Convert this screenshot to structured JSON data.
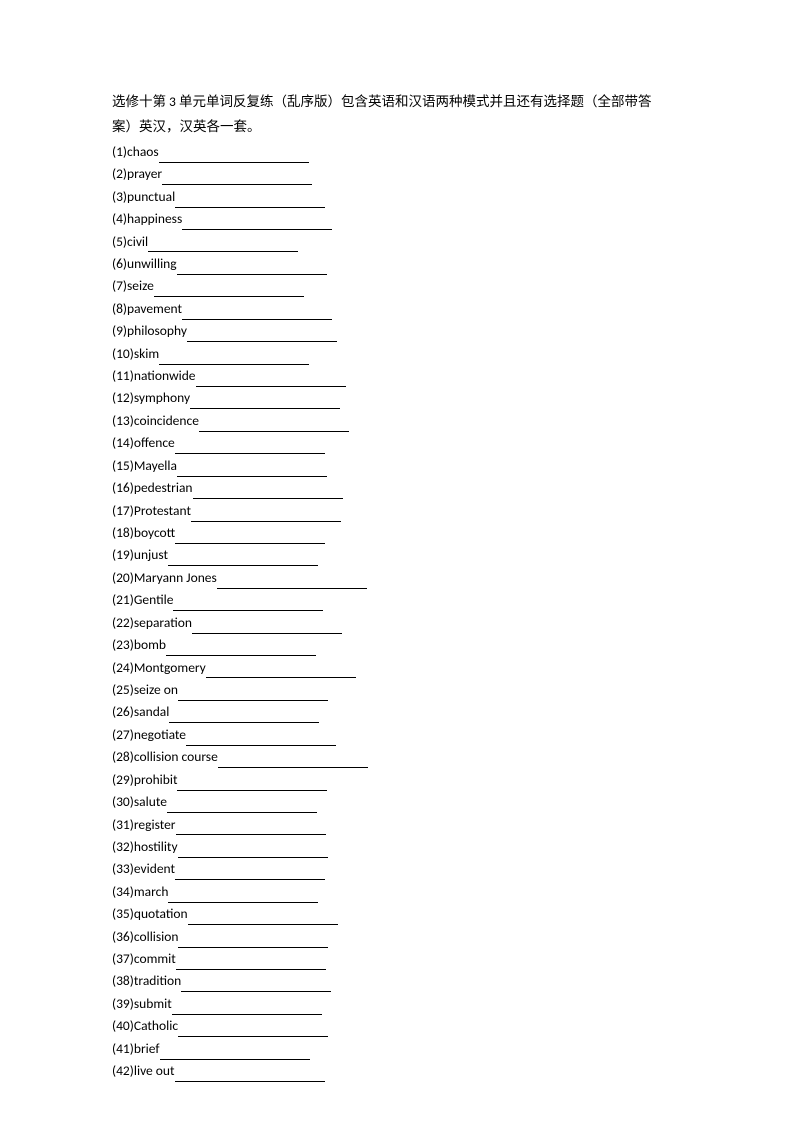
{
  "title_line1": "选修十第 3 单元单词反复练（乱序版）包含英语和汉语两种模式并且还有选择题（全部带答",
  "title_line2": "案）英汉，汉英各一套。",
  "items": [
    {
      "n": "(1)",
      "word": "chaos"
    },
    {
      "n": "(2)",
      "word": "prayer"
    },
    {
      "n": "(3)",
      "word": "punctual"
    },
    {
      "n": "(4)",
      "word": "happiness"
    },
    {
      "n": "(5)",
      "word": "civil"
    },
    {
      "n": "(6)",
      "word": "unwilling"
    },
    {
      "n": "(7)",
      "word": "seize"
    },
    {
      "n": "(8)",
      "word": "pavement"
    },
    {
      "n": "(9)",
      "word": "philosophy"
    },
    {
      "n": "(10)",
      "word": "skim"
    },
    {
      "n": "(11)",
      "word": "nationwide"
    },
    {
      "n": "(12)",
      "word": "symphony"
    },
    {
      "n": "(13)",
      "word": "coincidence"
    },
    {
      "n": "(14)",
      "word": "offence"
    },
    {
      "n": "(15)",
      "word": "Mayella"
    },
    {
      "n": "(16)",
      "word": "pedestrian"
    },
    {
      "n": "(17)",
      "word": "Protestant"
    },
    {
      "n": "(18)",
      "word": "boycott"
    },
    {
      "n": "(19)",
      "word": "unjust"
    },
    {
      "n": "(20)",
      "word": "Maryann Jones"
    },
    {
      "n": "(21)",
      "word": "Gentile"
    },
    {
      "n": "(22)",
      "word": "separation"
    },
    {
      "n": "(23)",
      "word": "bomb"
    },
    {
      "n": "(24)",
      "word": "Montgomery"
    },
    {
      "n": "(25)",
      "word": "seize on"
    },
    {
      "n": "(26)",
      "word": "sandal"
    },
    {
      "n": "(27)",
      "word": "negotiate"
    },
    {
      "n": "(28)",
      "word": "collision course"
    },
    {
      "n": "(29)",
      "word": "prohibit"
    },
    {
      "n": "(30)",
      "word": "salute"
    },
    {
      "n": "(31)",
      "word": "register"
    },
    {
      "n": "(32)",
      "word": "hostility"
    },
    {
      "n": "(33)",
      "word": "evident"
    },
    {
      "n": "(34)",
      "word": "march"
    },
    {
      "n": "(35)",
      "word": "quotation"
    },
    {
      "n": "(36)",
      "word": "collision"
    },
    {
      "n": "(37)",
      "word": "commit"
    },
    {
      "n": "(38)",
      "word": "tradition"
    },
    {
      "n": "(39)",
      "word": "submit"
    },
    {
      "n": "(40)",
      "word": "Catholic"
    },
    {
      "n": "(41)",
      "word": "brief"
    },
    {
      "n": "(42)",
      "word": "live out"
    }
  ]
}
